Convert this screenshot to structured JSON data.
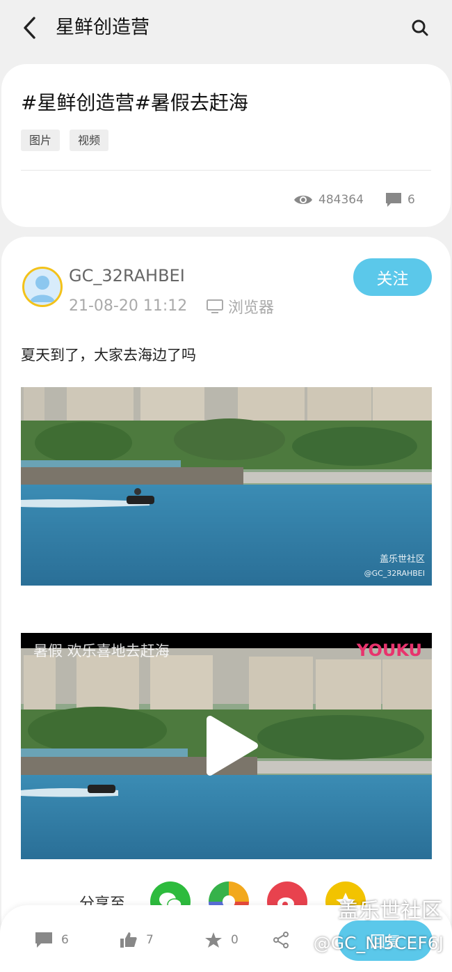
{
  "header": {
    "title": "星鲜创造营",
    "back_icon": "chevron-left-icon",
    "search_icon": "search-icon"
  },
  "topic": {
    "title": "#星鲜创造营#暑假去赶海",
    "tags": [
      "图片",
      "视频"
    ],
    "views": "484364",
    "comments": "6"
  },
  "post": {
    "username": "GC_32RAHBEI",
    "time": "21-08-20 11:12",
    "device": "浏览器",
    "follow_label": "关注",
    "text": "夏天到了，大家去海边了吗",
    "photo_watermark_line1": "盖乐世社区",
    "photo_watermark_line2": "@GC_32RAHBEI",
    "video_caption": "暑假 欢乐喜地去赶海",
    "video_brand": "YOUKU"
  },
  "share": {
    "label": "分享至"
  },
  "actions": {
    "comments": "6",
    "likes": "7",
    "favorites": "0",
    "reply_label": "回复"
  },
  "watermark": {
    "line1": "盖乐世社区",
    "line2": "@GC_NI5CEF6J"
  },
  "colors": {
    "accent": "#5bc8ea",
    "avatar_ring": "#f3c21a",
    "youku_pink": "#e8336d",
    "youku_blue": "#1fa7e8"
  }
}
